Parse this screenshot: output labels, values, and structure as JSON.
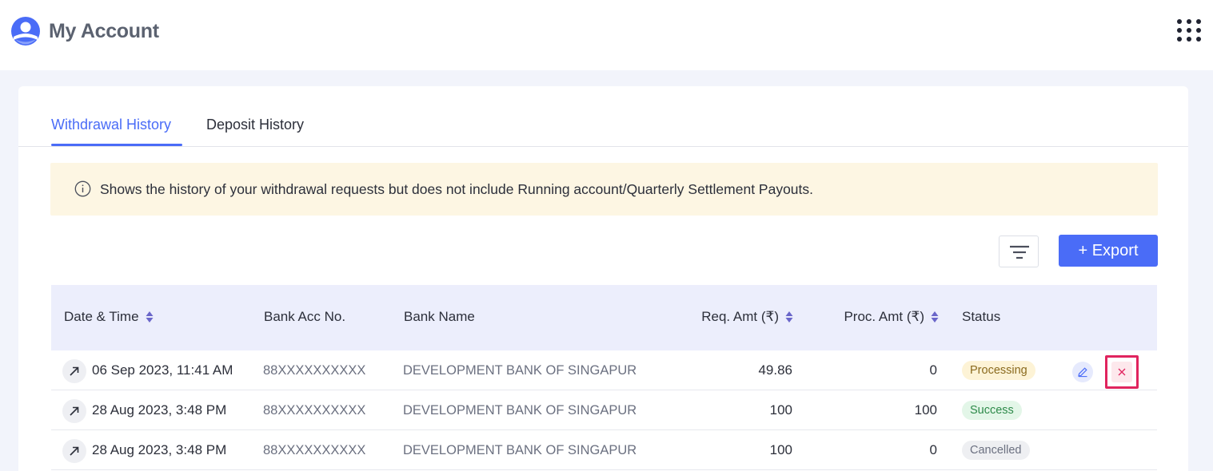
{
  "header": {
    "title": "My Account",
    "logo_icon": "user-profile-icon",
    "apps_icon": "grid-dots-icon"
  },
  "tabs": [
    {
      "label": "Withdrawal History",
      "active": true
    },
    {
      "label": "Deposit History",
      "active": false
    }
  ],
  "notice": {
    "icon": "info-icon",
    "text": "Shows the history of your withdrawal requests but does not include Running account/Quarterly Settlement Payouts."
  },
  "toolbar": {
    "filter_icon": "filter-icon",
    "export_label": "+ Export"
  },
  "table": {
    "columns": [
      {
        "label": "Date & Time",
        "sortable": true
      },
      {
        "label": "Bank Acc No.",
        "sortable": false
      },
      {
        "label": "Bank Name",
        "sortable": false
      },
      {
        "label": "Req. Amt (₹)",
        "sortable": true
      },
      {
        "label": "Proc. Amt (₹)",
        "sortable": true
      },
      {
        "label": "Status",
        "sortable": false
      }
    ],
    "rows": [
      {
        "datetime": "06 Sep 2023, 11:41 AM",
        "account": "88XXXXXXXXXX",
        "bank": "DEVELOPMENT BANK OF SINGAPUR",
        "req_amt": "49.86",
        "proc_amt": "0",
        "status": "Processing",
        "actions": true
      },
      {
        "datetime": "28 Aug 2023, 3:48 PM",
        "account": "88XXXXXXXXXX",
        "bank": "DEVELOPMENT BANK OF SINGAPUR",
        "req_amt": "100",
        "proc_amt": "100",
        "status": "Success",
        "actions": false
      },
      {
        "datetime": "28 Aug 2023, 3:48 PM",
        "account": "88XXXXXXXXXX",
        "bank": "DEVELOPMENT BANK OF SINGAPUR",
        "req_amt": "100",
        "proc_amt": "0",
        "status": "Cancelled",
        "actions": false
      }
    ]
  },
  "colors": {
    "accent": "#4a6cf7",
    "notice_bg": "#fdf6e3",
    "header_bg": "#eceefc",
    "highlight": "#e0245e"
  }
}
